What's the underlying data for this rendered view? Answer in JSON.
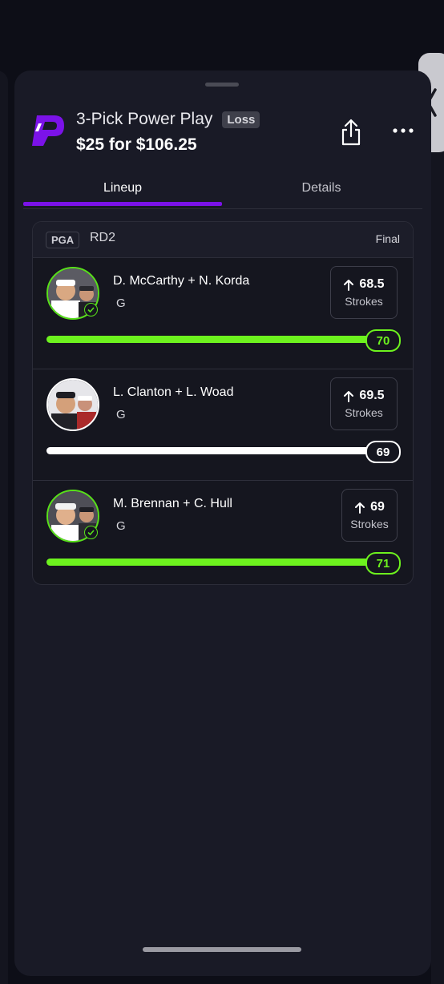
{
  "header": {
    "title": "3-Pick Power Play",
    "result_badge": "Loss",
    "subtitle": "$25 for $106.25",
    "icons": [
      "logo-icon",
      "share-icon",
      "more-icon",
      "chevron-left-icon"
    ]
  },
  "tabs": [
    {
      "label": "Lineup",
      "active": true
    },
    {
      "label": "Details",
      "active": false
    }
  ],
  "card": {
    "league": "PGA",
    "round": "RD2",
    "status": "Final"
  },
  "picks": [
    {
      "names": "D. McCarthy + N. Korda",
      "position": "G",
      "line": "68.5",
      "unit": "Strokes",
      "direction": "up",
      "result": "70",
      "won": true,
      "progress_pct": 100,
      "bar_color": "#6df21e"
    },
    {
      "names": "L. Clanton + L. Woad",
      "position": "G",
      "line": "69.5",
      "unit": "Strokes",
      "direction": "up",
      "result": "69",
      "won": false,
      "progress_pct": 100,
      "bar_color": "#ffffff"
    },
    {
      "names": "M. Brennan + C. Hull",
      "position": "G",
      "line": "69",
      "unit": "Strokes",
      "direction": "up",
      "result": "71",
      "won": true,
      "progress_pct": 100,
      "bar_color": "#6df21e"
    }
  ],
  "colors": {
    "accent": "#7b12e8",
    "win": "#6df21e",
    "background": "#0d0e17",
    "sheet": "#191a26"
  }
}
